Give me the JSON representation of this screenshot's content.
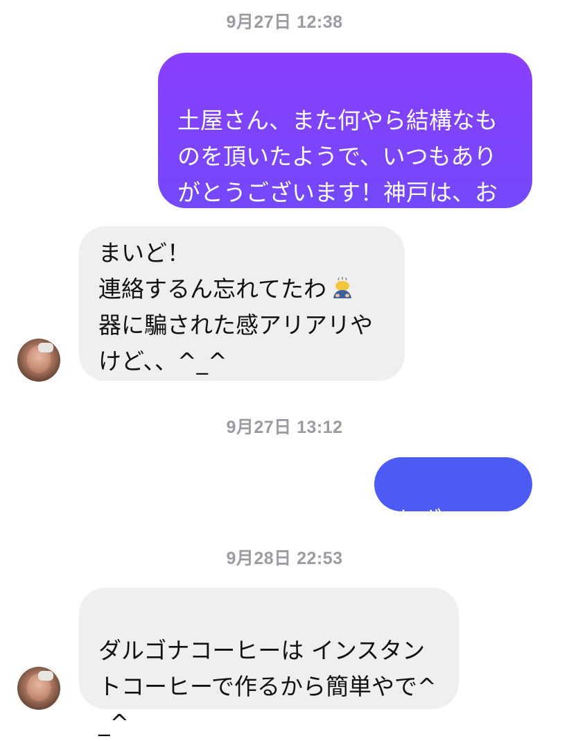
{
  "conversation": {
    "timestamps": [
      "9月27日 12:38",
      "9月27日 13:12",
      "9月28日 22:53"
    ],
    "messages": [
      {
        "direction": "outgoing",
        "text": "土屋さん、また何やら結構なものを頂いたようで、いつもありがとうございます！神戸は、お天気で良かったですですね。"
      },
      {
        "direction": "incoming",
        "line1": "まいど！",
        "line2": "連絡するん忘れてたわ",
        "emoji": "person-bowing-emoji",
        "rest": "器に騙された感アリアリやけど、、^_^"
      },
      {
        "direction": "outgoing",
        "text": "あざーす！"
      },
      {
        "direction": "incoming",
        "text": "ダルゴナコーヒーは インスタントコーヒーで作るから簡単やで^_^"
      }
    ],
    "colors": {
      "outgoing_gradient_top": "#8a3ffc",
      "outgoing_gradient_bottom": "#6a4dfb",
      "outgoing_solid": "#4d5bf5",
      "incoming_bg": "#efefef",
      "timestamp": "#9b9ba1"
    }
  }
}
